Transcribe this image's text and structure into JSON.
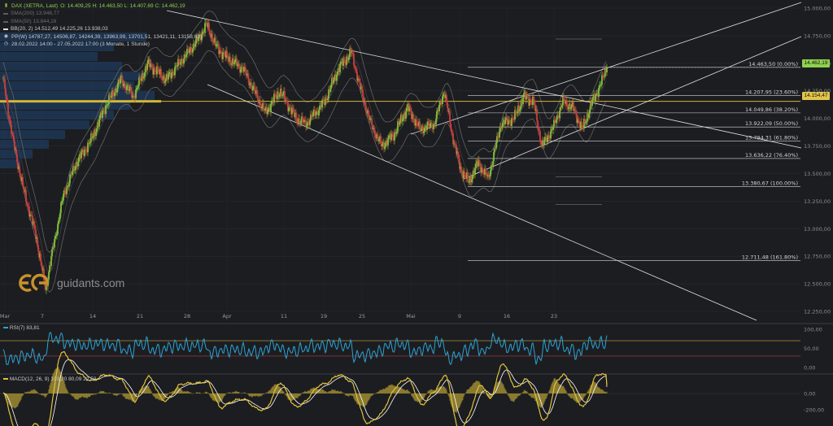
{
  "header": {
    "instrument": "DAX (XETRA, Last)",
    "ohlc": "O: 14.409,25  H: 14.463,50  L: 14.407,69  C: 14.462,19",
    "sma200": "SMA(200)  13.946,77",
    "sma50": "SMA(50)  13.844,16",
    "bb": "BB(20, 2)  14.512,49  14.225,26  13.938,03",
    "pp": "PP(W)  14787,27, 14506,87, 14244,39, 13963,99, 13701,51, 13421,11, 13158,63)",
    "range": "28.02.2022 14:00 - 27.05.2022 17:00  (3 Monate, 1 Stunde)"
  },
  "watermark": "guidants.com",
  "colors": {
    "background": "#1c1d21",
    "up_candle": "#7fbf3c",
    "down_candle": "#c6403d",
    "fib_line": "#d9d9d9",
    "channel": "#e2e2e2",
    "support": "#d2b53a",
    "last_price_tag": "#8fd14f",
    "support_tag": "#e1c44a",
    "volume_profile": "#1e4d80",
    "rsi": "#2aa4d6",
    "macd": "#e1c23c",
    "signal": "#ffffff",
    "histogram": "#8a7a2e"
  },
  "price_labels": {
    "last": "14.462,19",
    "support": "14.154,47"
  },
  "rsi_legend": "RSI(7)  83,81",
  "macd_legend": "MACD(12, 26, 9)  103,20  80,09  22,52",
  "chart_data": {
    "type": "candlestick",
    "period": "28.02.2022 14:00 - 27.05.2022 17:00",
    "y_axis": {
      "min": 12250,
      "max": 15000,
      "ticks": [
        "15.000,00",
        "14.750,00",
        "14.500,00",
        "14.250,00",
        "14.000,00",
        "13.750,00",
        "13.500,00",
        "13.250,00",
        "13.000,00",
        "12.750,00",
        "12.500,00",
        "12.250,00"
      ]
    },
    "x_ticks": [
      "Mar",
      "7",
      "14",
      "21",
      "28",
      "Apr",
      "11",
      "19",
      "25",
      "Mai",
      "9",
      "16",
      "23"
    ],
    "anchors": [
      {
        "x": 0,
        "price": 14350
      },
      {
        "x": 12,
        "price": 13800
      },
      {
        "x": 24,
        "price": 13380
      },
      {
        "x": 40,
        "price": 12950
      },
      {
        "x": 52,
        "price": 12450
      },
      {
        "x": 62,
        "price": 12850
      },
      {
        "x": 74,
        "price": 13300
      },
      {
        "x": 90,
        "price": 13600
      },
      {
        "x": 108,
        "price": 13800
      },
      {
        "x": 125,
        "price": 14100
      },
      {
        "x": 145,
        "price": 14350
      },
      {
        "x": 160,
        "price": 14200
      },
      {
        "x": 178,
        "price": 14500
      },
      {
        "x": 200,
        "price": 14350
      },
      {
        "x": 222,
        "price": 14550
      },
      {
        "x": 238,
        "price": 14700
      },
      {
        "x": 250,
        "price": 14850
      },
      {
        "x": 262,
        "price": 14650
      },
      {
        "x": 275,
        "price": 14550
      },
      {
        "x": 295,
        "price": 14450
      },
      {
        "x": 322,
        "price": 14050
      },
      {
        "x": 340,
        "price": 14250
      },
      {
        "x": 360,
        "price": 14000
      },
      {
        "x": 372,
        "price": 13950
      },
      {
        "x": 395,
        "price": 14150
      },
      {
        "x": 412,
        "price": 14450
      },
      {
        "x": 428,
        "price": 14600
      },
      {
        "x": 440,
        "price": 14250
      },
      {
        "x": 452,
        "price": 13950
      },
      {
        "x": 465,
        "price": 13750
      },
      {
        "x": 480,
        "price": 13850
      },
      {
        "x": 497,
        "price": 14100
      },
      {
        "x": 512,
        "price": 13900
      },
      {
        "x": 530,
        "price": 13950
      },
      {
        "x": 542,
        "price": 14250
      },
      {
        "x": 552,
        "price": 13850
      },
      {
        "x": 562,
        "price": 13550
      },
      {
        "x": 572,
        "price": 13420
      },
      {
        "x": 584,
        "price": 13600
      },
      {
        "x": 596,
        "price": 13450
      },
      {
        "x": 612,
        "price": 13950
      },
      {
        "x": 628,
        "price": 14000
      },
      {
        "x": 640,
        "price": 14200
      },
      {
        "x": 652,
        "price": 14150
      },
      {
        "x": 662,
        "price": 13750
      },
      {
        "x": 675,
        "price": 13900
      },
      {
        "x": 688,
        "price": 14150
      },
      {
        "x": 700,
        "price": 14100
      },
      {
        "x": 712,
        "price": 13900
      },
      {
        "x": 724,
        "price": 14150
      },
      {
        "x": 734,
        "price": 14300
      },
      {
        "x": 742,
        "price": 14462
      }
    ],
    "fibonacci": [
      {
        "label": "14.463,50 (0.00%)",
        "price": 14463.5
      },
      {
        "label": "14.207,95 (23.60%)",
        "price": 14207.95
      },
      {
        "label": "14.049,86 (38.20%)",
        "price": 14049.86
      },
      {
        "label": "13.922,09 (50.00%)",
        "price": 13922.09
      },
      {
        "label": "13.794,31 (61.80%)",
        "price": 13794.31
      },
      {
        "label": "13.636,22 (76.40%)",
        "price": 13636.22
      },
      {
        "label": "13.380,67 (100.00%)",
        "price": 13380.67
      },
      {
        "label": "12.711,48 (161.80%)",
        "price": 12711.48
      }
    ],
    "support_price": 14154.47,
    "last_price": 14462.19,
    "rsi": {
      "ticks": [
        "100,00",
        "50,00",
        "0,00"
      ],
      "last": 83.81
    },
    "macd": {
      "ticks": [
        "0,00",
        "-200,00"
      ],
      "macd": 103.2,
      "signal": 80.09,
      "histogram": 22.52
    }
  }
}
